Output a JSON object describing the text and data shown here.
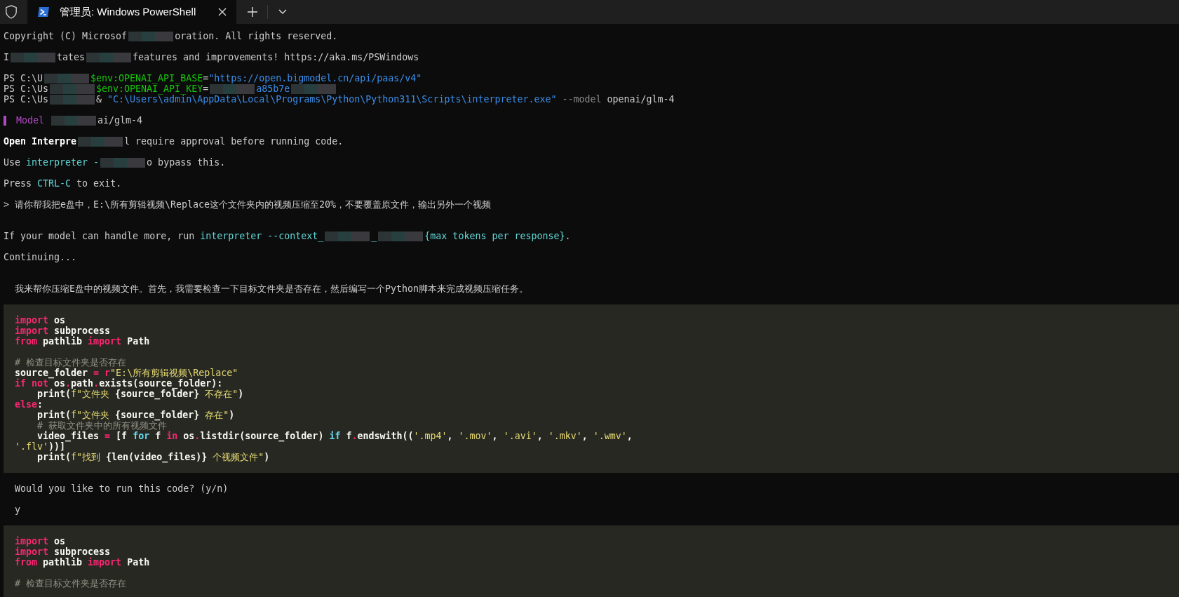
{
  "tab_bar": {
    "tabs": [
      {
        "title": "管理员: Windows PowerShell",
        "selected": true
      }
    ]
  },
  "terminal": {
    "blocks": [
      {
        "kind": "output",
        "lines": [
          {
            "kind": "text",
            "segments": [
              {
                "kind": "plain",
                "text": "Copyright (C) Microsof"
              },
              {
                "kind": "redacted"
              },
              {
                "kind": "plain",
                "text": "oration. All rights reserved."
              }
            ]
          },
          {
            "kind": "blank"
          },
          {
            "kind": "text",
            "segments": [
              {
                "kind": "plain",
                "text": "I"
              },
              {
                "kind": "redacted"
              },
              {
                "kind": "plain",
                "text": "tates"
              },
              {
                "kind": "redacted"
              },
              {
                "kind": "plain",
                "text": "features and improvements! https://aka.ms/PSWindows"
              }
            ]
          },
          {
            "kind": "blank"
          },
          {
            "kind": "text",
            "segments": [
              {
                "kind": "plain",
                "text": "PS C:\\U"
              },
              {
                "kind": "redacted"
              },
              {
                "kind": "green",
                "text": "$env:OPENAI_API_BASE"
              },
              {
                "kind": "plain",
                "text": "="
              },
              {
                "kind": "string",
                "text": "\"https://open.bigmodel.cn/api/paas/v4\""
              }
            ]
          },
          {
            "kind": "text",
            "segments": [
              {
                "kind": "plain",
                "text": "PS C:\\Us"
              },
              {
                "kind": "redacted"
              },
              {
                "kind": "green",
                "text": "$env:OPENAI_API_KEY"
              },
              {
                "kind": "plain",
                "text": "="
              },
              {
                "kind": "redacted"
              },
              {
                "kind": "string",
                "text": "a85b7e"
              },
              {
                "kind": "redacted"
              }
            ]
          },
          {
            "kind": "text",
            "segments": [
              {
                "kind": "plain",
                "text": "PS C:\\Us"
              },
              {
                "kind": "redacted"
              },
              {
                "kind": "plain",
                "text": "& "
              },
              {
                "kind": "string",
                "text": "\"C:\\Users\\admin\\AppData\\Local\\Programs\\Python\\Python311\\Scripts\\interpreter.exe\""
              },
              {
                "kind": "flag",
                "text": " --model"
              },
              {
                "kind": "plain",
                "text": " openai/glm-4"
              }
            ]
          },
          {
            "kind": "blank"
          },
          {
            "kind": "text",
            "segments": [
              {
                "kind": "bar"
              },
              {
                "kind": "purple",
                "text": " Model "
              },
              {
                "kind": "redacted"
              },
              {
                "kind": "plain",
                "text": "ai/glm-4"
              }
            ]
          },
          {
            "kind": "blank"
          },
          {
            "kind": "text",
            "segments": [
              {
                "kind": "bold",
                "text": "Open Interpre"
              },
              {
                "kind": "redacted"
              },
              {
                "kind": "plain",
                "text": "l require approval before running code."
              }
            ]
          },
          {
            "kind": "blank"
          },
          {
            "kind": "text",
            "segments": [
              {
                "kind": "plain",
                "text": "Use "
              },
              {
                "kind": "cyan",
                "text": "interpreter -"
              },
              {
                "kind": "redacted"
              },
              {
                "kind": "plain",
                "text": "o bypass this."
              }
            ]
          },
          {
            "kind": "blank"
          },
          {
            "kind": "text",
            "segments": [
              {
                "kind": "plain",
                "text": "Press "
              },
              {
                "kind": "cyan",
                "text": "CTRL-C"
              },
              {
                "kind": "plain",
                "text": " to exit."
              }
            ]
          },
          {
            "kind": "blank"
          },
          {
            "kind": "text",
            "segments": [
              {
                "kind": "plain",
                "text": "> 请你帮我把e盘中，E:\\所有剪辑视频\\Replace这个文件夹内的视频压缩至20%，不要覆盖原文件，输出另外一个视频"
              }
            ]
          },
          {
            "kind": "blank"
          },
          {
            "kind": "blank"
          },
          {
            "kind": "text",
            "segments": [
              {
                "kind": "plain",
                "text": "If your model can handle more, run "
              },
              {
                "kind": "cyan",
                "text": "interpreter --context_"
              },
              {
                "kind": "redacted"
              },
              {
                "kind": "cyan",
                "text": "_"
              },
              {
                "kind": "redacted"
              },
              {
                "kind": "cyan",
                "text": "{max tokens per response}"
              },
              {
                "kind": "plain",
                "text": "."
              }
            ]
          },
          {
            "kind": "blank"
          },
          {
            "kind": "text",
            "segments": [
              {
                "kind": "plain",
                "text": "Continuing..."
              }
            ]
          },
          {
            "kind": "blank"
          },
          {
            "kind": "blank"
          },
          {
            "kind": "text",
            "segments": [
              {
                "kind": "plain",
                "text": "  我来帮你压缩E盘中的视频文件。首先，我需要检查一下目标文件夹是否存在，然后编写一个Python脚本来完成视频压缩任务。"
              }
            ]
          },
          {
            "kind": "blank"
          }
        ]
      },
      {
        "kind": "code",
        "lines": [
          {
            "kind": "text",
            "segments": [
              {
                "kind": "keyword",
                "text": "import"
              },
              {
                "kind": "plain",
                "text": " os"
              }
            ]
          },
          {
            "kind": "text",
            "segments": [
              {
                "kind": "keyword",
                "text": "import"
              },
              {
                "kind": "plain",
                "text": " subprocess"
              }
            ]
          },
          {
            "kind": "text",
            "segments": [
              {
                "kind": "keyword",
                "text": "from"
              },
              {
                "kind": "plain",
                "text": " pathlib "
              },
              {
                "kind": "keyword",
                "text": "import"
              },
              {
                "kind": "plain",
                "text": " Path"
              }
            ]
          },
          {
            "kind": "blank"
          },
          {
            "kind": "text",
            "segments": [
              {
                "kind": "comment",
                "text": "# 检查目标文件夹是否存在"
              }
            ]
          },
          {
            "kind": "text",
            "segments": [
              {
                "kind": "plain",
                "text": "source_folder "
              },
              {
                "kind": "keyword",
                "text": "= r"
              },
              {
                "kind": "str",
                "text": "\"E:\\所有剪辑视频\\Replace\""
              }
            ]
          },
          {
            "kind": "text",
            "segments": [
              {
                "kind": "keyword",
                "text": "if not"
              },
              {
                "kind": "plain",
                "text": " os"
              },
              {
                "kind": "keyword",
                "text": "."
              },
              {
                "kind": "plain",
                "text": "path"
              },
              {
                "kind": "keyword",
                "text": "."
              },
              {
                "kind": "plain",
                "text": "exists(source_folder):"
              }
            ]
          },
          {
            "kind": "text",
            "segments": [
              {
                "kind": "plain",
                "text": "    print("
              },
              {
                "kind": "str",
                "text": "f\"文件夹 "
              },
              {
                "kind": "plain",
                "text": "{source_folder}"
              },
              {
                "kind": "str",
                "text": " 不存在\""
              },
              {
                "kind": "plain",
                "text": ")"
              }
            ]
          },
          {
            "kind": "text",
            "segments": [
              {
                "kind": "keyword",
                "text": "else"
              },
              {
                "kind": "plain",
                "text": ":"
              }
            ]
          },
          {
            "kind": "text",
            "segments": [
              {
                "kind": "plain",
                "text": "    print("
              },
              {
                "kind": "str",
                "text": "f\"文件夹 "
              },
              {
                "kind": "plain",
                "text": "{source_folder}"
              },
              {
                "kind": "str",
                "text": " 存在\""
              },
              {
                "kind": "plain",
                "text": ")"
              }
            ]
          },
          {
            "kind": "text",
            "segments": [
              {
                "kind": "comment",
                "text": "    # 获取文件夹中的所有视频文件"
              }
            ]
          },
          {
            "kind": "text",
            "segments": [
              {
                "kind": "plain",
                "text": "    video_files "
              },
              {
                "kind": "keyword",
                "text": "="
              },
              {
                "kind": "plain",
                "text": " [f "
              },
              {
                "kind": "func",
                "text": "for"
              },
              {
                "kind": "plain",
                "text": " f "
              },
              {
                "kind": "keyword",
                "text": "in"
              },
              {
                "kind": "plain",
                "text": " os"
              },
              {
                "kind": "keyword",
                "text": "."
              },
              {
                "kind": "plain",
                "text": "listdir(source_folder) "
              },
              {
                "kind": "func",
                "text": "if"
              },
              {
                "kind": "plain",
                "text": " f"
              },
              {
                "kind": "keyword",
                "text": "."
              },
              {
                "kind": "plain",
                "text": "endswith(("
              },
              {
                "kind": "str",
                "text": "'.mp4'"
              },
              {
                "kind": "plain",
                "text": ", "
              },
              {
                "kind": "str",
                "text": "'.mov'"
              },
              {
                "kind": "plain",
                "text": ", "
              },
              {
                "kind": "str",
                "text": "'.avi'"
              },
              {
                "kind": "plain",
                "text": ", "
              },
              {
                "kind": "str",
                "text": "'.mkv'"
              },
              {
                "kind": "plain",
                "text": ", "
              },
              {
                "kind": "str",
                "text": "'.wmv'"
              },
              {
                "kind": "plain",
                "text": ","
              }
            ]
          },
          {
            "kind": "text",
            "segments": [
              {
                "kind": "str",
                "text": "'.flv'"
              },
              {
                "kind": "plain",
                "text": "))]"
              }
            ]
          },
          {
            "kind": "text",
            "segments": [
              {
                "kind": "plain",
                "text": "    print("
              },
              {
                "kind": "str",
                "text": "f\"找到 "
              },
              {
                "kind": "plain",
                "text": "{len(video_files)}"
              },
              {
                "kind": "str",
                "text": " 个视频文件\""
              },
              {
                "kind": "plain",
                "text": ")"
              }
            ]
          }
        ]
      },
      {
        "kind": "output",
        "lines": [
          {
            "kind": "blank"
          },
          {
            "kind": "text",
            "segments": [
              {
                "kind": "plain",
                "text": "  Would you like to run this code? (y/n)"
              }
            ]
          },
          {
            "kind": "blank"
          },
          {
            "kind": "text",
            "segments": [
              {
                "kind": "plain",
                "text": "  y"
              }
            ]
          },
          {
            "kind": "blank"
          }
        ]
      },
      {
        "kind": "code",
        "lines": [
          {
            "kind": "text",
            "segments": [
              {
                "kind": "keyword",
                "text": "import"
              },
              {
                "kind": "plain",
                "text": " os"
              }
            ]
          },
          {
            "kind": "text",
            "segments": [
              {
                "kind": "keyword",
                "text": "import"
              },
              {
                "kind": "plain",
                "text": " subprocess"
              }
            ]
          },
          {
            "kind": "text",
            "segments": [
              {
                "kind": "keyword",
                "text": "from"
              },
              {
                "kind": "plain",
                "text": " pathlib "
              },
              {
                "kind": "keyword",
                "text": "import"
              },
              {
                "kind": "plain",
                "text": " Path"
              }
            ]
          },
          {
            "kind": "blank"
          },
          {
            "kind": "text",
            "segments": [
              {
                "kind": "comment",
                "text": "# 检查目标文件夹是否存在"
              }
            ]
          }
        ]
      }
    ]
  }
}
